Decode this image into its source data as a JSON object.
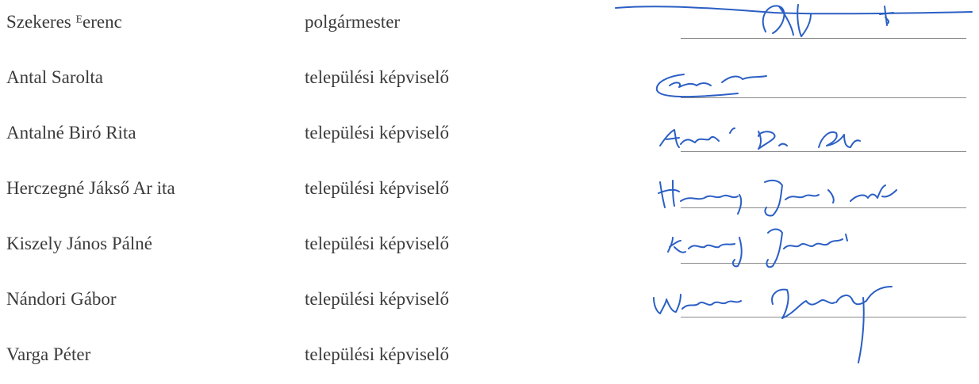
{
  "members": [
    {
      "name": "Szekeres ᴱerenc",
      "title": "polgármester"
    },
    {
      "name": "Antal Sarolta",
      "title": "települési képviselő"
    },
    {
      "name": "Antalné Biró Rita",
      "title": "települési képviselő"
    },
    {
      "name": "Herczegné Jákső Ar ita",
      "title": "települési képviselő"
    },
    {
      "name": "Kiszely János Pálné",
      "title": "települési képviselő"
    },
    {
      "name": "Nándori Gábor",
      "title": "települési képviselő"
    },
    {
      "name": "Varga Péter",
      "title": "települési képviselő"
    }
  ],
  "colors": {
    "text": "#3b3b3b",
    "signature_ink": "#2b5fc4",
    "rule": "#8a8a8a"
  }
}
